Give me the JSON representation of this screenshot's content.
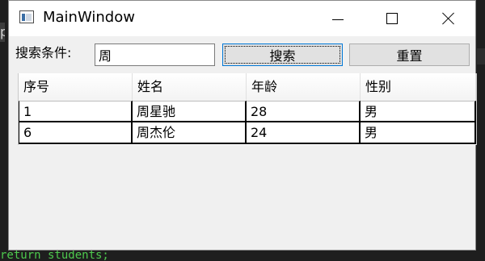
{
  "background": {
    "left_tab_text": "p",
    "code_line": "return students;"
  },
  "window": {
    "title": "MainWindow",
    "icon": "window-app-icon",
    "controls": {
      "minimize_icon": "minimize-icon",
      "maximize_icon": "maximize-icon",
      "close_icon": "close-icon"
    }
  },
  "search": {
    "label": "搜索条件:",
    "value": "周",
    "search_button": "搜索",
    "reset_button": "重置"
  },
  "table": {
    "columns": [
      "序号",
      "姓名",
      "年龄",
      "性别"
    ],
    "rows": [
      [
        "1",
        "周星驰",
        "28",
        "男"
      ],
      [
        "6",
        "周杰伦",
        "24",
        "男"
      ]
    ]
  },
  "colors": {
    "window_bg": "#f0f0f0",
    "focus_border": "#0078d7",
    "code_green": "#4ec94e"
  }
}
